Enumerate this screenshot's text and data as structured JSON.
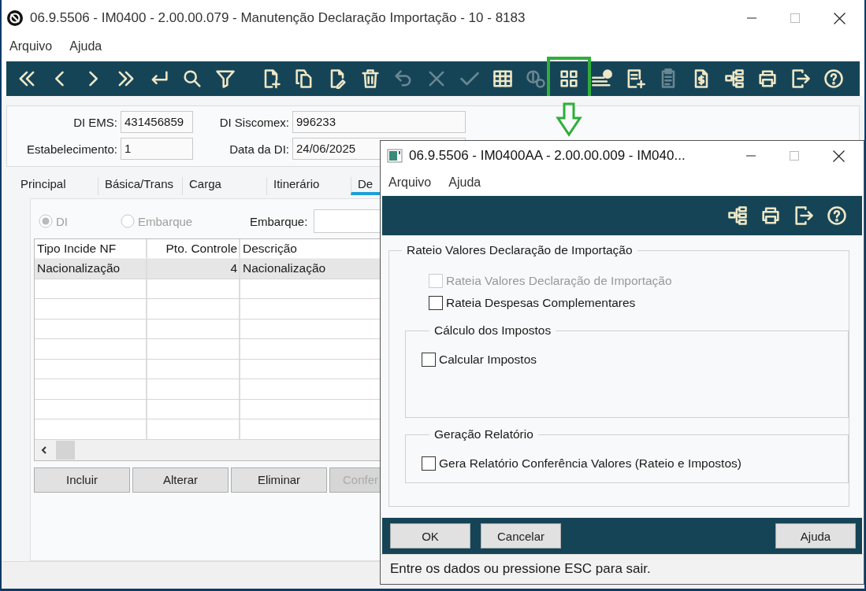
{
  "main_window": {
    "title": "06.9.5506 - IM0400 - 2.00.00.079 - Manutenção Declaração Importação - 10 - 8183",
    "menu": [
      "Arquivo",
      "Ajuda"
    ],
    "toolbar": [
      {
        "kind": "first",
        "disabled": false,
        "highlighted": false
      },
      {
        "kind": "prev",
        "disabled": false,
        "highlighted": false
      },
      {
        "kind": "next",
        "disabled": false,
        "highlighted": false
      },
      {
        "kind": "last",
        "disabled": false,
        "highlighted": false
      },
      {
        "kind": "goto",
        "disabled": false,
        "highlighted": false
      },
      {
        "kind": "search",
        "disabled": false,
        "highlighted": false
      },
      {
        "kind": "filter",
        "disabled": false,
        "highlighted": false
      },
      {
        "kind": "newdoc",
        "disabled": false,
        "highlighted": false
      },
      {
        "kind": "copy",
        "disabled": false,
        "highlighted": false
      },
      {
        "kind": "editdoc",
        "disabled": false,
        "highlighted": false
      },
      {
        "kind": "trash",
        "disabled": false,
        "highlighted": false
      },
      {
        "kind": "undo",
        "disabled": true,
        "highlighted": false
      },
      {
        "kind": "cancel",
        "disabled": true,
        "highlighted": false
      },
      {
        "kind": "confirm",
        "disabled": true,
        "highlighted": false
      },
      {
        "kind": "table",
        "disabled": false,
        "highlighted": false
      },
      {
        "kind": "coinhelp",
        "disabled": true,
        "highlighted": false
      },
      {
        "kind": "apps",
        "disabled": false,
        "highlighted": true
      },
      {
        "kind": "listbadge",
        "disabled": false,
        "highlighted": false
      },
      {
        "kind": "docplus",
        "disabled": false,
        "highlighted": false
      },
      {
        "kind": "clipboard",
        "disabled": true,
        "highlighted": false
      },
      {
        "kind": "docmoney",
        "disabled": false,
        "highlighted": false
      },
      {
        "kind": "tree",
        "disabled": false,
        "highlighted": false
      },
      {
        "kind": "print",
        "disabled": false,
        "highlighted": false
      },
      {
        "kind": "exit",
        "disabled": false,
        "highlighted": false
      },
      {
        "kind": "help",
        "disabled": false,
        "highlighted": false
      }
    ],
    "header_fields": [
      {
        "label": "DI EMS:",
        "value": "431456859"
      },
      {
        "label": "DI Siscomex:",
        "value": "996233"
      },
      {
        "label": "Estabelecimento:",
        "value": "1"
      },
      {
        "label": "Data da DI:",
        "value": "24/06/2025"
      }
    ],
    "tabs": [
      {
        "label": "Principal",
        "selected": false
      },
      {
        "label": "Básica/Trans",
        "selected": false
      },
      {
        "label": "Carga",
        "selected": false
      },
      {
        "label": "Itinerário",
        "selected": false
      },
      {
        "label": "De",
        "selected": true
      }
    ],
    "radios": [
      {
        "label": "DI",
        "selected": true,
        "disabled": true
      },
      {
        "label": "Embarque",
        "selected": false,
        "disabled": true
      }
    ],
    "embarque_field": {
      "label": "Embarque:"
    },
    "table": {
      "columns": [
        "Tipo Incide NF",
        "Pto. Controle",
        "Descrição"
      ],
      "rows": [
        {
          "cells": [
            "Nacionalização",
            "4",
            "Nacionalização"
          ],
          "selected": true
        }
      ]
    },
    "buttons": [
      {
        "label": "Incluir",
        "disabled": false
      },
      {
        "label": "Alterar",
        "disabled": false
      },
      {
        "label": "Eliminar",
        "disabled": false
      },
      {
        "label": "Confer",
        "disabled": true
      }
    ]
  },
  "dialog": {
    "title": "06.9.5506 - IM0400AA - 2.00.00.009 - IM040...",
    "menu": [
      "Arquivo",
      "Ajuda"
    ],
    "toolbar": [
      {
        "kind": "tree",
        "disabled": false,
        "highlighted": false
      },
      {
        "kind": "print",
        "disabled": false,
        "highlighted": false
      },
      {
        "kind": "exit",
        "disabled": false,
        "highlighted": false
      },
      {
        "kind": "help",
        "disabled": false,
        "highlighted": false
      }
    ],
    "group": {
      "title": "Rateio Valores Declaração de Importação",
      "options": [
        {
          "label": "Rateia Valores Declaração de Importação",
          "checked": false,
          "disabled": true
        },
        {
          "label": "Rateia Despesas Complementares",
          "checked": false,
          "disabled": false
        }
      ],
      "subgroups": [
        {
          "title": "Cálculo dos Impostos",
          "options": [
            {
              "label": "Calcular Impostos",
              "checked": false,
              "disabled": false
            }
          ]
        },
        {
          "title": "Geração Relatório",
          "options": [
            {
              "label": "Gera Relatório Conferência Valores (Rateio e Impostos)",
              "checked": false,
              "disabled": false
            }
          ]
        }
      ]
    },
    "buttons": [
      {
        "label": "OK"
      },
      {
        "label": "Cancelar"
      },
      {
        "label": "Ajuda"
      }
    ],
    "status_bar": "Entre os dados ou pressione ESC para sair."
  }
}
